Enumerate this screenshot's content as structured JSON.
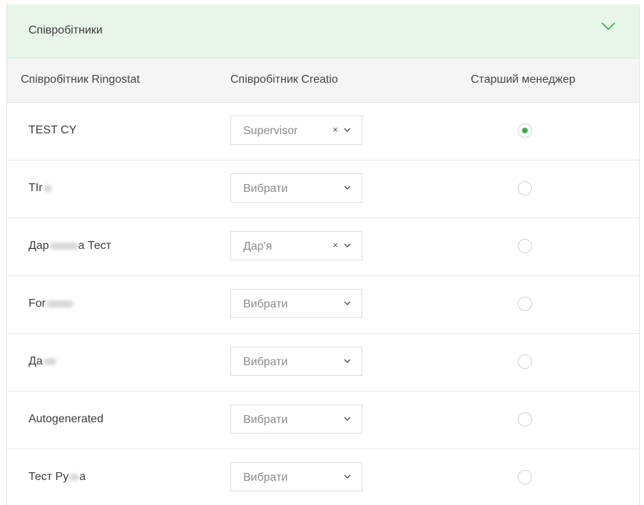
{
  "panel": {
    "title": "Співробітники",
    "expand_icon": "chevron-down-icon",
    "accent_color": "#3ea84a",
    "header_bg": "#e8f6ea"
  },
  "columns": {
    "ringostat": "Співробітник Ringostat",
    "creatio": "Співробітник Creatio",
    "senior": "Старший менеджер"
  },
  "rows": [
    {
      "name": "TEST CY",
      "select_value": "Supervisor",
      "placeholder": false,
      "clearable": true,
      "senior": true
    },
    {
      "name": "TIr",
      "select_value": "Вибрати",
      "placeholder": true,
      "clearable": false,
      "senior": false
    },
    {
      "name": "Дар",
      "name_suffix": "а Тест",
      "select_value": "Дар'я",
      "placeholder": false,
      "clearable": true,
      "senior": false
    },
    {
      "name": "For",
      "select_value": "Вибрати",
      "placeholder": true,
      "clearable": false,
      "senior": false
    },
    {
      "name": "Да",
      "select_value": "Вибрати",
      "placeholder": true,
      "clearable": false,
      "senior": false
    },
    {
      "name": "Autogenerated",
      "select_value": "Вибрати",
      "placeholder": true,
      "clearable": false,
      "senior": false
    },
    {
      "name": "Тест Ру",
      "name_suffix": "а",
      "select_value": "Вибрати",
      "placeholder": true,
      "clearable": false,
      "senior": false
    }
  ],
  "clear_symbol": "×"
}
